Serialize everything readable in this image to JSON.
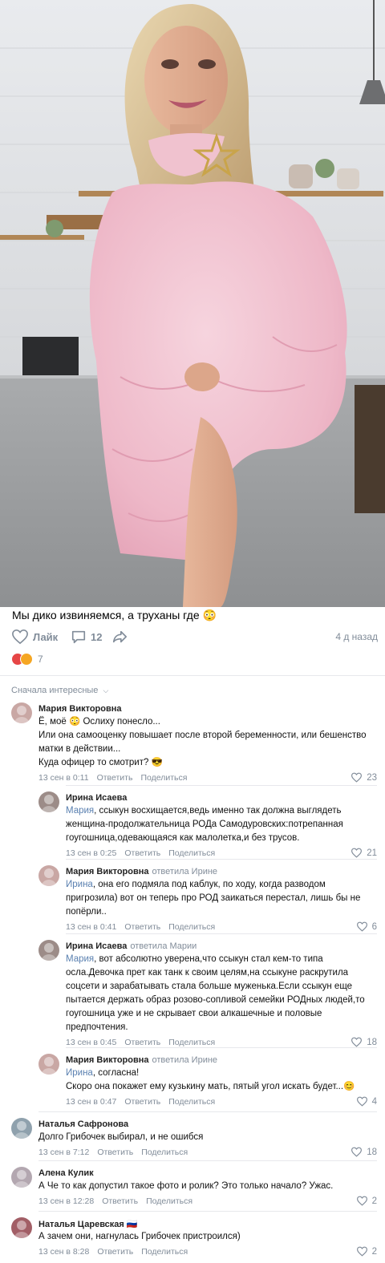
{
  "post": {
    "caption": "Мы дико извиняемся, а труханы где 😳",
    "like_label": "Лайк",
    "comments_count": "12",
    "time_ago": "4 д назад",
    "reactions_count": "7",
    "reaction_colors": [
      "#e64646",
      "#f5a623"
    ]
  },
  "sort_label": "Сначала интересные",
  "comments": [
    {
      "author": "Мария Викторовна",
      "reply_to": "",
      "mention": "",
      "lines": [
        "Ё, моё 😳 Ослиху понесло...",
        "Или она самооценку повышает после второй беременности, или бешенство",
        "матки в действии...",
        "Куда офицер то смотрит? 😎"
      ],
      "date": "13 сен в 0:11",
      "reply_label": "Ответить",
      "share_label": "Поделиться",
      "likes": "23"
    },
    {
      "author": "Ирина Исаева",
      "reply_to": "",
      "mention": "Мария",
      "lines": [
        ", ссыкун восхищается,ведь именно так должна выглядеть",
        "женщина-продолжательница РОДа Самодуровских:потрепанная",
        "гоугошница,одевающаяся как малолетка,и без трусов."
      ],
      "date": "13 сен в 0:25",
      "reply_label": "Ответить",
      "share_label": "Поделиться",
      "likes": "21"
    },
    {
      "author": "Мария Викторовна",
      "reply_to": "ответила Ирине",
      "mention": "Ирина",
      "lines": [
        ", она его подмяла под каблук, по ходу, когда разводом",
        "пригрозила) вот он теперь про РОД заикаться перестал, лишь бы не",
        "попёрли.."
      ],
      "date": "13 сен в 0:41",
      "reply_label": "Ответить",
      "share_label": "Поделиться",
      "likes": "6"
    },
    {
      "author": "Ирина Исаева",
      "reply_to": "ответила Марии",
      "mention": "Мария",
      "lines": [
        ", вот абсолютно уверена,что ссыкун стал кем-то типа",
        "осла.Девочка прет как танк к своим целям,на ссыкуне раскрутила",
        "соцсети и зарабатывать стала больше муженька.Если ссыкун еще",
        "пытается держать образ розово-сопливой семейки РОДных людей,то",
        "гоугошница уже и не скрывает свои алкашечные и половые",
        "предпочтения."
      ],
      "date": "13 сен в 0:45",
      "reply_label": "Ответить",
      "share_label": "Поделиться",
      "likes": "18"
    },
    {
      "author": "Мария Викторовна",
      "reply_to": "ответила Ирине",
      "mention": "Ирина",
      "lines": [
        ", согласна!",
        "Скоро она покажет ему кузькину мать, пятый угол искать будет...😊"
      ],
      "date": "13 сен в 0:47",
      "reply_label": "Ответить",
      "share_label": "Поделиться",
      "likes": "4"
    },
    {
      "author": "Наталья Сафронова",
      "reply_to": "",
      "mention": "",
      "lines": [
        "Долго Грибочек выбирал, и не ошибся"
      ],
      "date": "13 сен в 7:12",
      "reply_label": "Ответить",
      "share_label": "Поделиться",
      "likes": "18"
    },
    {
      "author": "Алена Кулик",
      "reply_to": "",
      "mention": "",
      "lines": [
        "А Че то как допустил такое фото и ролик? Это только начало? Ужас."
      ],
      "date": "13 сен в 12:28",
      "reply_label": "Ответить",
      "share_label": "Поделиться",
      "likes": "2"
    },
    {
      "author": "Наталья Царевская 🇷🇺",
      "reply_to": "",
      "mention": "",
      "lines": [
        "А зачем они, нагнулась Грибочек пристроился)"
      ],
      "date": "13 сен в 8:28",
      "reply_label": "Ответить",
      "share_label": "Поделиться",
      "likes": "2"
    }
  ]
}
